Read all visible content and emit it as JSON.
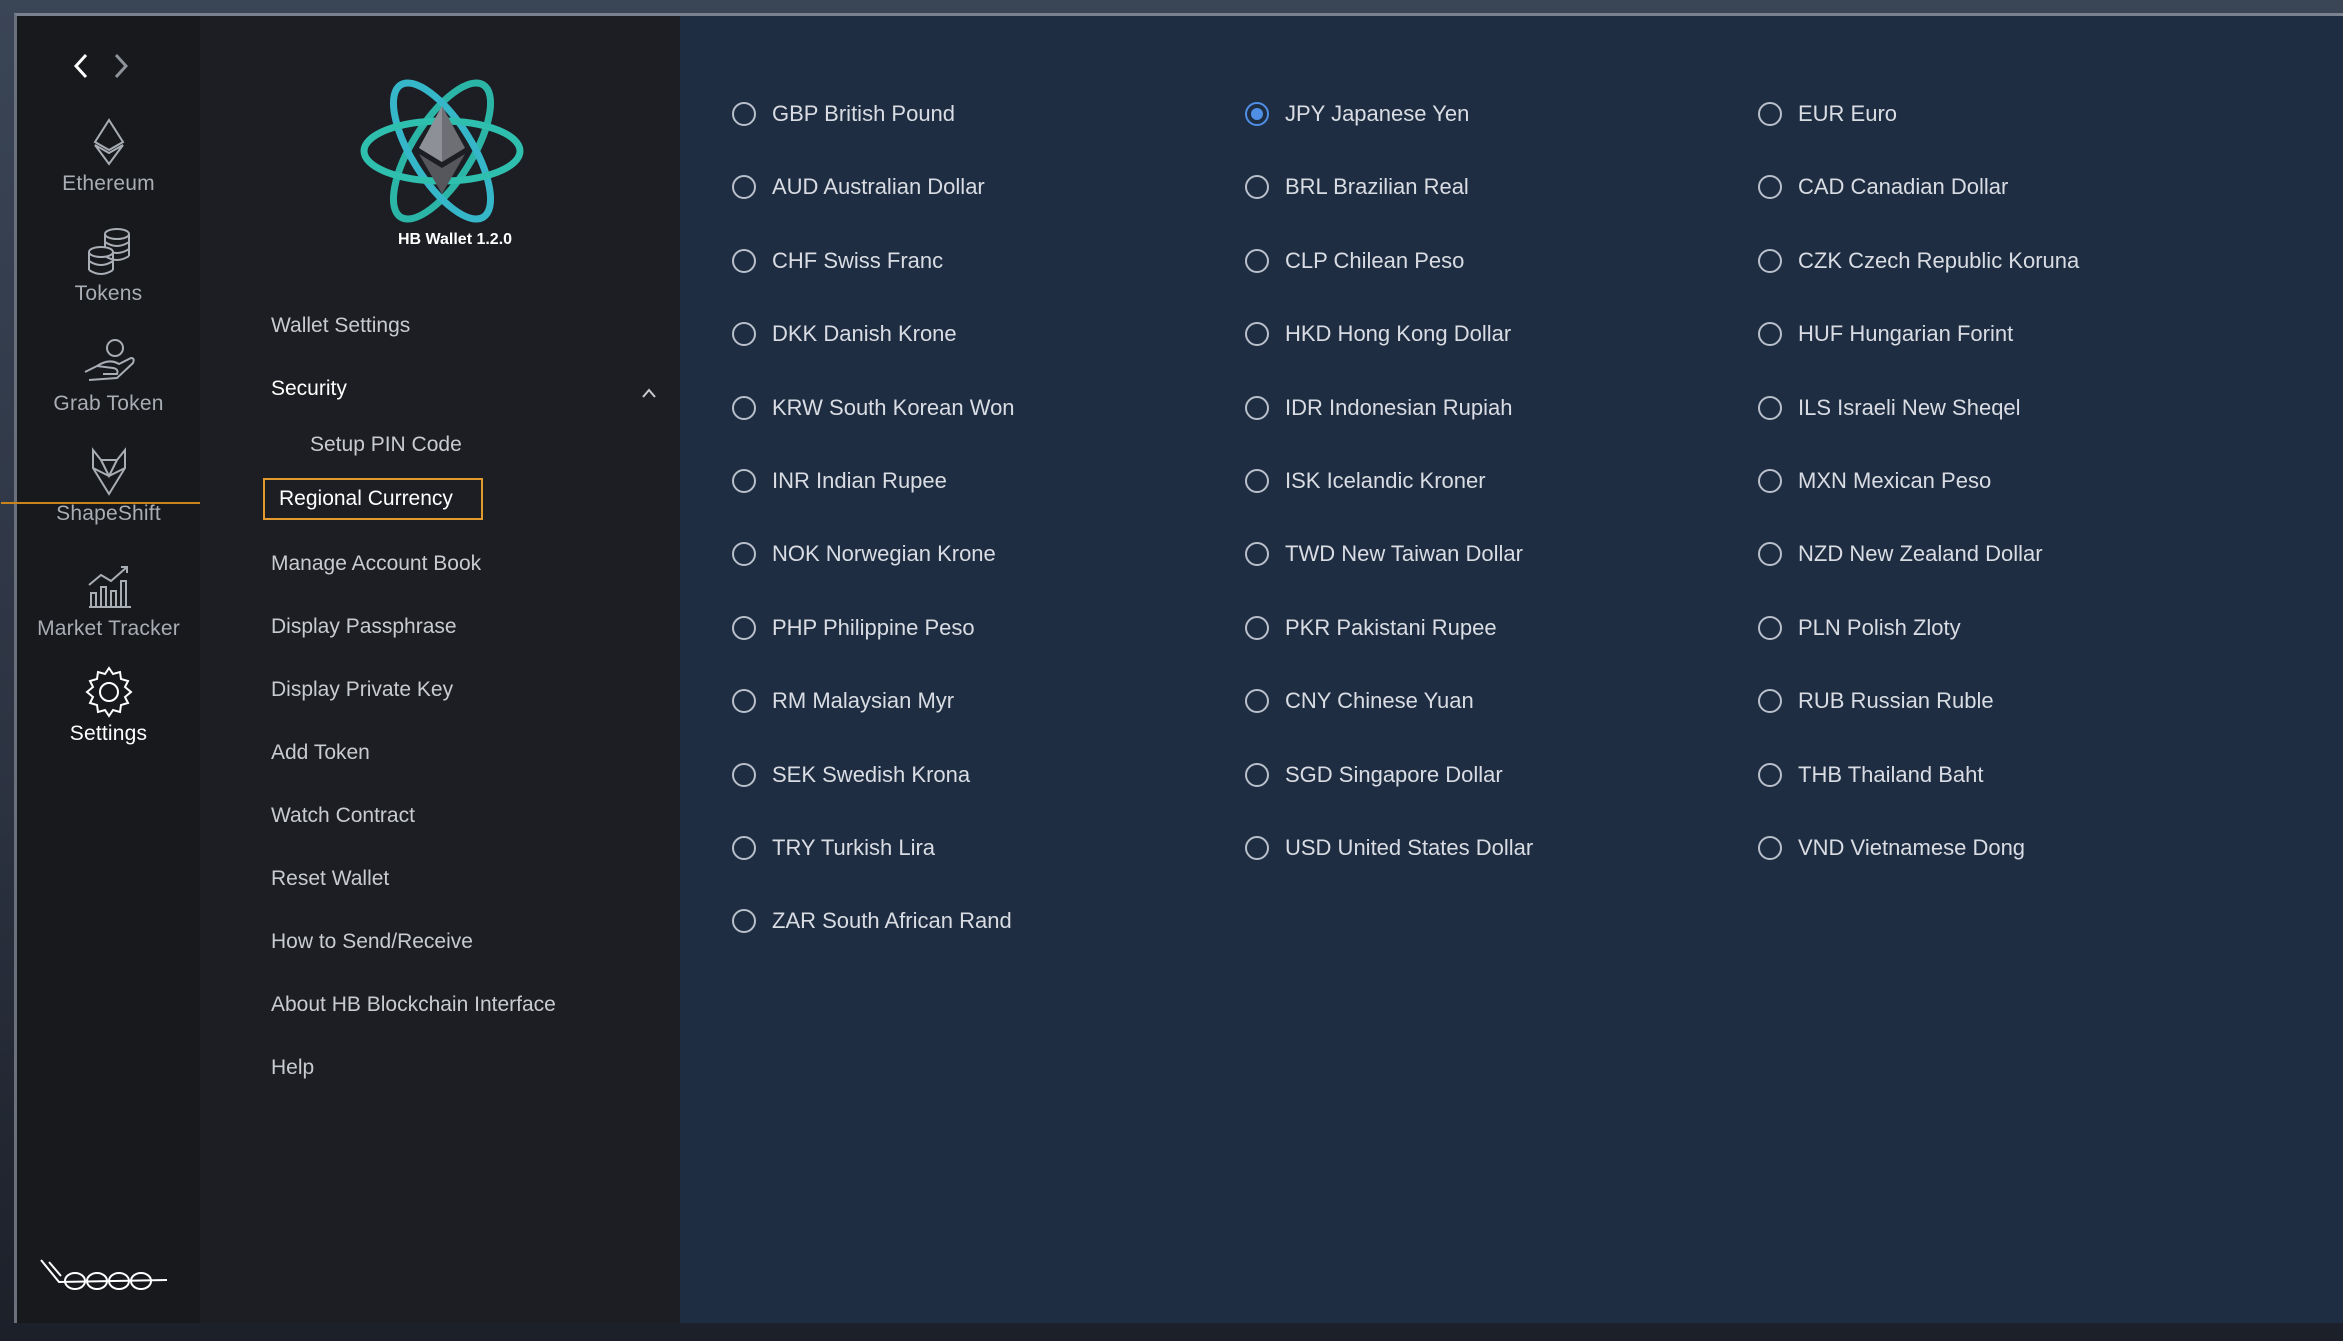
{
  "app": {
    "version_label": "HB Wallet 1.2.0"
  },
  "rail": {
    "items": [
      {
        "label": "Ethereum",
        "icon": "ethereum-icon"
      },
      {
        "label": "Tokens",
        "icon": "tokens-icon"
      },
      {
        "label": "Grab Token",
        "icon": "grab-token-icon"
      },
      {
        "label": "ShapeShift",
        "icon": "shapeshift-fox-icon"
      },
      {
        "label": "Market Tracker",
        "icon": "market-tracker-icon"
      },
      {
        "label": "Settings",
        "icon": "gear-icon",
        "active": true
      }
    ]
  },
  "menu": {
    "wallet_settings": "Wallet Settings",
    "security": "Security",
    "setup_pin": "Setup PIN Code",
    "regional_currency": "Regional Currency",
    "manage_account_book": "Manage Account Book",
    "display_passphrase": "Display Passphrase",
    "display_private_key": "Display Private Key",
    "add_token": "Add Token",
    "watch_contract": "Watch Contract",
    "reset_wallet": "Reset Wallet",
    "how_to": "How to Send/Receive",
    "about": "About HB Blockchain Interface",
    "help": "Help"
  },
  "currencies": {
    "selected": "JPY Japanese Yen",
    "col1": [
      "GBP British Pound",
      "AUD Australian Dollar",
      "CHF Swiss Franc",
      "DKK Danish Krone",
      "KRW South Korean Won",
      "INR Indian Rupee",
      "NOK Norwegian Krone",
      "PHP Philippine Peso",
      "RM Malaysian Myr",
      "SEK Swedish Krona",
      "TRY Turkish Lira",
      "ZAR South African Rand"
    ],
    "col2": [
      "JPY Japanese Yen",
      "BRL Brazilian Real",
      "CLP Chilean Peso",
      "HKD Hong Kong Dollar",
      "IDR Indonesian Rupiah",
      "ISK Icelandic Kroner",
      "TWD New Taiwan Dollar",
      "PKR Pakistani Rupee",
      "CNY Chinese Yuan",
      "SGD Singapore Dollar",
      "USD United States Dollar"
    ],
    "col3": [
      "EUR Euro",
      "CAD Canadian Dollar",
      "CZK Czech Republic Koruna",
      "HUF Hungarian Forint",
      "ILS Israeli New Sheqel",
      "MXN Mexican Peso",
      "NZD New Zealand Dollar",
      "PLN Polish Zloty",
      "RUB Russian Ruble",
      "THB Thailand Baht",
      "VND Vietnamese Dong"
    ]
  },
  "colors": {
    "accent_selected_border": "#e29a2d",
    "radio_checked": "#4f8fe6",
    "content_bg": "#1f2d42"
  }
}
